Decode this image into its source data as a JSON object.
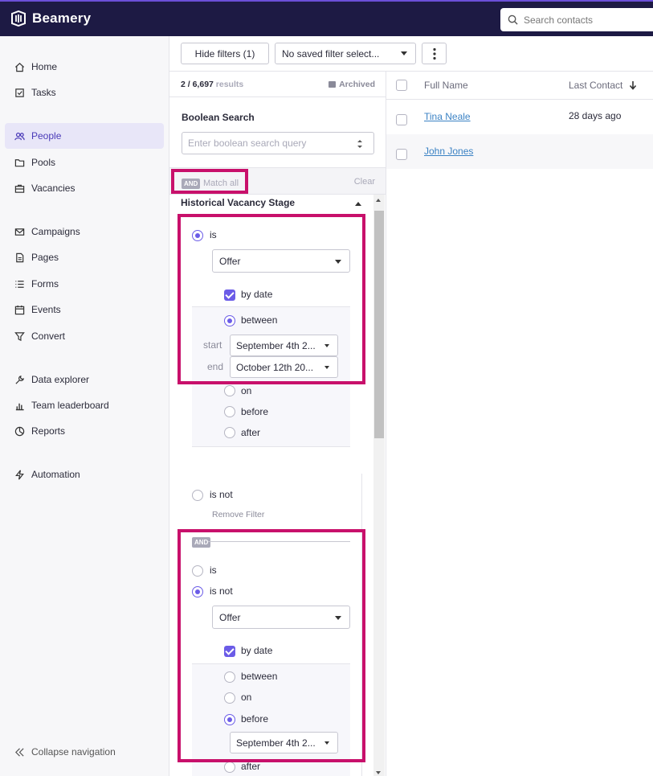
{
  "app": {
    "name": "Beamery"
  },
  "search": {
    "placeholder": "Search contacts"
  },
  "nav": {
    "items": [
      {
        "label": "Home",
        "icon": "home-icon"
      },
      {
        "label": "Tasks",
        "icon": "tasks-icon"
      },
      {
        "label": "People",
        "icon": "people-icon",
        "active": true
      },
      {
        "label": "Pools",
        "icon": "folder-icon"
      },
      {
        "label": "Vacancies",
        "icon": "briefcase-icon"
      },
      {
        "label": "Campaigns",
        "icon": "mail-icon"
      },
      {
        "label": "Pages",
        "icon": "page-icon"
      },
      {
        "label": "Forms",
        "icon": "list-icon"
      },
      {
        "label": "Events",
        "icon": "calendar-icon"
      },
      {
        "label": "Convert",
        "icon": "funnel-icon"
      },
      {
        "label": "Data explorer",
        "icon": "wrench-icon"
      },
      {
        "label": "Team leaderboard",
        "icon": "bar-chart-icon"
      },
      {
        "label": "Reports",
        "icon": "pie-chart-icon"
      },
      {
        "label": "Automation",
        "icon": "bolt-icon"
      }
    ],
    "collapse_label": "Collapse navigation"
  },
  "toolbar": {
    "hide_filters_label": "Hide filters (1)",
    "saved_filter_value": "No saved filter select..."
  },
  "results": {
    "count": "2 / 6,697",
    "suffix": "results",
    "archived_label": "Archived"
  },
  "boolean_search": {
    "title": "Boolean Search",
    "placeholder": "Enter boolean search query"
  },
  "match": {
    "tag": "AND",
    "label": "Match all",
    "clear_label": "Clear"
  },
  "filter": {
    "title": "Historical Vacancy Stage",
    "block1": {
      "is_label": "is",
      "stage_value": "Offer",
      "by_date_label": "by date",
      "between_label": "between",
      "start_label": "start",
      "start_value": "September 4th 2...",
      "end_label": "end",
      "end_value": "October 12th 20...",
      "on_label": "on",
      "before_label": "before",
      "after_label": "after",
      "is_not_label": "is not",
      "remove_label": "Remove Filter"
    },
    "and_tag": "AND",
    "block2": {
      "is_label": "is",
      "is_not_label": "is not",
      "stage_value": "Offer",
      "by_date_label": "by date",
      "between_label": "between",
      "on_label": "on",
      "before_label": "before",
      "before_value": "September 4th 2...",
      "after_label": "after"
    }
  },
  "list": {
    "columns": {
      "name": "Full Name",
      "last_contact": "Last Contact"
    },
    "rows": [
      {
        "name": "Tina Neale",
        "last_contact": "28 days ago"
      },
      {
        "name": "John Jones",
        "last_contact": ""
      }
    ]
  },
  "colors": {
    "topbar": "#1d1a44",
    "accent": "#6b5ce7",
    "highlight": "#c8106b",
    "link": "#3b82c4"
  }
}
